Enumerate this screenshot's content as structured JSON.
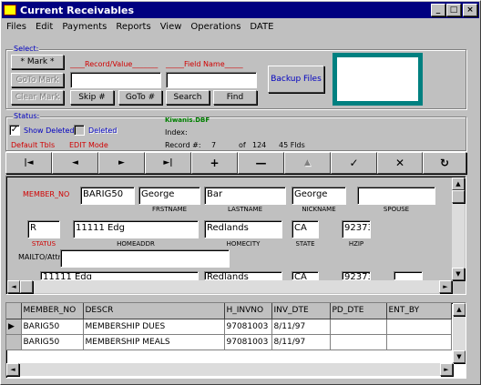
{
  "window": {
    "title": "Current Receivables",
    "controls": {
      "minimize": "_",
      "maximize": "□",
      "close": "×"
    }
  },
  "menu": [
    "Files",
    "Edit",
    "Payments",
    "Reports",
    "View",
    "Operations",
    "DATE"
  ],
  "select": {
    "group_label": "Select:",
    "mark_button": "* Mark *",
    "goto_mark_button": "GoTo Mark",
    "clear_mark_button": "Clear Mark",
    "skip_button": "Skip #",
    "goto_button": "GoTo #",
    "search_button": "Search",
    "find_button": "Find",
    "record_value_label": "____Record/Value_______",
    "field_name_label": "_____Field Name_____",
    "record_value": "",
    "field_name": "",
    "backup_button": "Backup Files"
  },
  "status": {
    "group_label": "Status:",
    "show_deleted_label": "Show Deleted",
    "show_deleted_checked": true,
    "deleted_label": "Deleted",
    "deleted_checked": false,
    "dbf_name": "Kiwanis.DBF",
    "index_label": "Index:",
    "default_tbls": "Default Tbls",
    "edit_mode": "EDIT Mode",
    "record_label": "Record #:",
    "record_num": "7",
    "of_label": "of",
    "record_total": "124",
    "flds": "45 Flds"
  },
  "nav": [
    "|◄",
    "◄",
    "►",
    "►|",
    "+",
    "—",
    "▲",
    "✓",
    "✕",
    "↻"
  ],
  "form": {
    "member_no_label": "MEMBER_NO",
    "member_no": "BARIG50",
    "frstname": "George",
    "lastname": "Bar",
    "nickname": "George",
    "spouse": "",
    "frstname_label": "FRSTNAME",
    "lastname_label": "LASTNAME",
    "nickname_label": "NICKNAME",
    "spouse_label": "SPOUSE",
    "status": "R",
    "homeaddr": "11111 Edg",
    "homecity": "Redlands",
    "state": "CA",
    "hzip": "92373",
    "status_label": "STATUS",
    "homeaddr_label": "HOMEADDR",
    "homecity_label": "HOMECITY",
    "state_label": "STATE",
    "hzip_label": "HZIP",
    "mailto_label": "MAILTO/Attn:",
    "mailto": "",
    "row3_addr": "11111 Edg",
    "row3_city": "Redlands",
    "row3_state": "CA",
    "row3_zip": "92373"
  },
  "grid": {
    "columns": [
      "MEMBER_NO",
      "DESCR",
      "H_INVNO",
      "INV_DTE",
      "PD_DTE",
      "ENT_BY"
    ],
    "rows": [
      [
        "BARIG50",
        "MEMBERSHIP DUES",
        "97081003",
        "8/11/97",
        "",
        ""
      ],
      [
        "BARIG50",
        "MEMBERSHIP MEALS",
        "97081003",
        "8/11/97",
        "",
        ""
      ]
    ]
  },
  "colors": {
    "title_bg": "#000080",
    "face": "#c0c0c0",
    "teal": "#008080",
    "red_label": "#d00000",
    "blue_label": "#0000c0"
  }
}
